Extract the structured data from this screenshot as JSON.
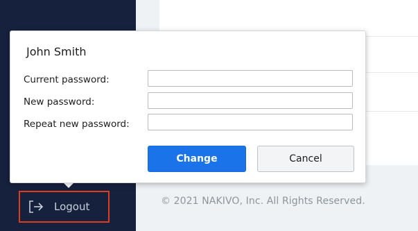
{
  "app": {
    "accent": "#1a73e8",
    "sidebar_color": "#16213d",
    "highlight_color": "#e23c1f"
  },
  "popup": {
    "user_name": "John Smith",
    "fields": [
      {
        "label": "Current password:",
        "value": "",
        "placeholder": ""
      },
      {
        "label": "New password:",
        "value": "",
        "placeholder": ""
      },
      {
        "label": "Repeat new password:",
        "value": "",
        "placeholder": ""
      }
    ],
    "change_label": "Change",
    "cancel_label": "Cancel"
  },
  "sidebar": {
    "logout_label": "Logout",
    "logout_icon": "logout-icon"
  },
  "footer": {
    "copyright": "© 2021 NAKIVO, Inc. All Rights Reserved."
  }
}
